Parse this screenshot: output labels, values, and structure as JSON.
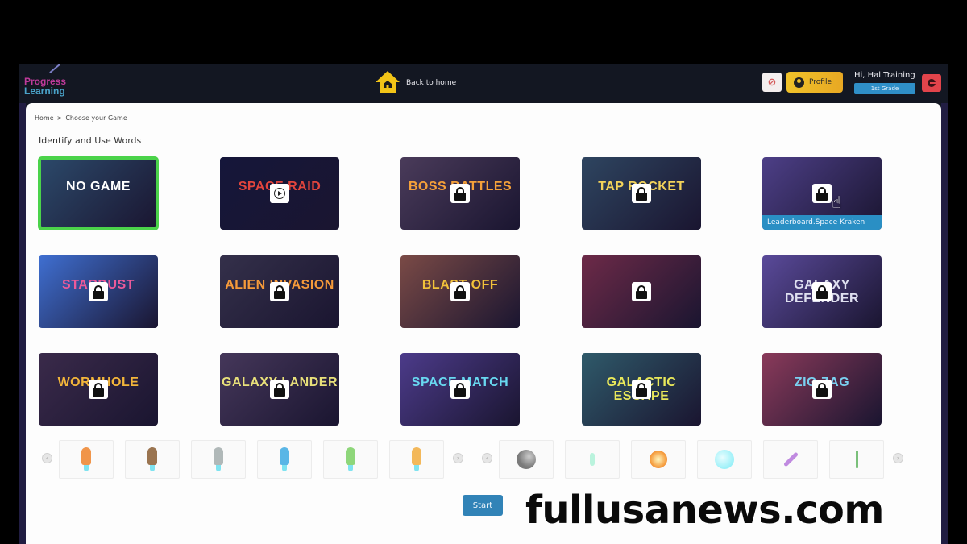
{
  "header": {
    "logo_line1": "Progress",
    "logo_line2": "Learning",
    "back_home_label": "Back to home",
    "profile_label": "Profile",
    "user_greeting": "Hi, Hal Training",
    "grade": "1st Grade",
    "notification_icon": "bell-off-icon",
    "logout_icon": "logout-icon"
  },
  "breadcrumb": {
    "home": "Home",
    "separator": ">",
    "current": "Choose your Game"
  },
  "section_title": "Identify and Use Words",
  "games": [
    {
      "title": "NO GAME",
      "state": "selected",
      "colors": {
        "bg": "#2c4a6b",
        "text": "#ffffff"
      }
    },
    {
      "title": "SPACE RAID",
      "state": "playable",
      "colors": {
        "bg": "#15163a",
        "text": "#e2453d"
      }
    },
    {
      "title": "BOSS BATTLES",
      "state": "locked",
      "colors": {
        "bg": "#4a3b5a",
        "text": "#f5a13a"
      }
    },
    {
      "title": "TAP ROCKET",
      "state": "locked",
      "colors": {
        "bg": "#2e4560",
        "text": "#f3d35a"
      }
    },
    {
      "title": "",
      "state": "locked",
      "hover_label": "Leaderboard.Space Kraken",
      "colors": {
        "bg": "#4d3f87",
        "text": "#ffffff"
      }
    },
    {
      "title": "STARDUST",
      "state": "locked",
      "colors": {
        "bg": "#3f6fd1",
        "text": "#ec5a9a"
      }
    },
    {
      "title": "ALIEN INVASION",
      "state": "locked",
      "colors": {
        "bg": "#34304a",
        "text": "#f59a3a"
      }
    },
    {
      "title": "BLAST OFF",
      "state": "locked",
      "colors": {
        "bg": "#7a4a46",
        "text": "#f2c23a"
      }
    },
    {
      "title": "",
      "state": "locked",
      "colors": {
        "bg": "#6d2a48",
        "text": "#a96ae8"
      }
    },
    {
      "title": "GALAXY DEFENDER",
      "state": "locked",
      "colors": {
        "bg": "#5a4a9a",
        "text": "#dfe0f0"
      }
    },
    {
      "title": "WORMHOLE",
      "state": "locked",
      "colors": {
        "bg": "#3a2a4a",
        "text": "#f2b53a"
      }
    },
    {
      "title": "GALAXY LANDER",
      "state": "locked",
      "colors": {
        "bg": "#45375a",
        "text": "#e8e07a"
      }
    },
    {
      "title": "SPACE MATCH",
      "state": "locked",
      "colors": {
        "bg": "#4c3b8a",
        "text": "#68d8f0"
      }
    },
    {
      "title": "GALACTIC ESCAPE",
      "state": "locked",
      "colors": {
        "bg": "#2f5a6a",
        "text": "#e9e85a"
      }
    },
    {
      "title": "ZIG ZAG",
      "state": "locked",
      "colors": {
        "bg": "#8a3a5a",
        "text": "#7ad0f0"
      }
    }
  ],
  "ships": [
    {
      "name": "orange-rocket",
      "color": "#f0954a"
    },
    {
      "name": "brown-rocket",
      "color": "#9a7450"
    },
    {
      "name": "silver-rocket",
      "color": "#b0b8b8"
    },
    {
      "name": "blue-rocket",
      "color": "#5ab6e6"
    },
    {
      "name": "green-rocket",
      "color": "#8ed67a"
    },
    {
      "name": "yellow-rocket",
      "color": "#f3b85a"
    }
  ],
  "projectiles": [
    {
      "name": "gray-ball",
      "color": "#7a7a7a"
    },
    {
      "name": "green-beam",
      "color": "#9ef0d0"
    },
    {
      "name": "fireball",
      "color": "#f59a3a"
    },
    {
      "name": "cyan-orb",
      "color": "#9af0f8"
    },
    {
      "name": "purple-laser",
      "color": "#c08ae0"
    },
    {
      "name": "green-missile",
      "color": "#7ac07a"
    }
  ],
  "start_label": "Start",
  "watermark": "fullusanews.com"
}
